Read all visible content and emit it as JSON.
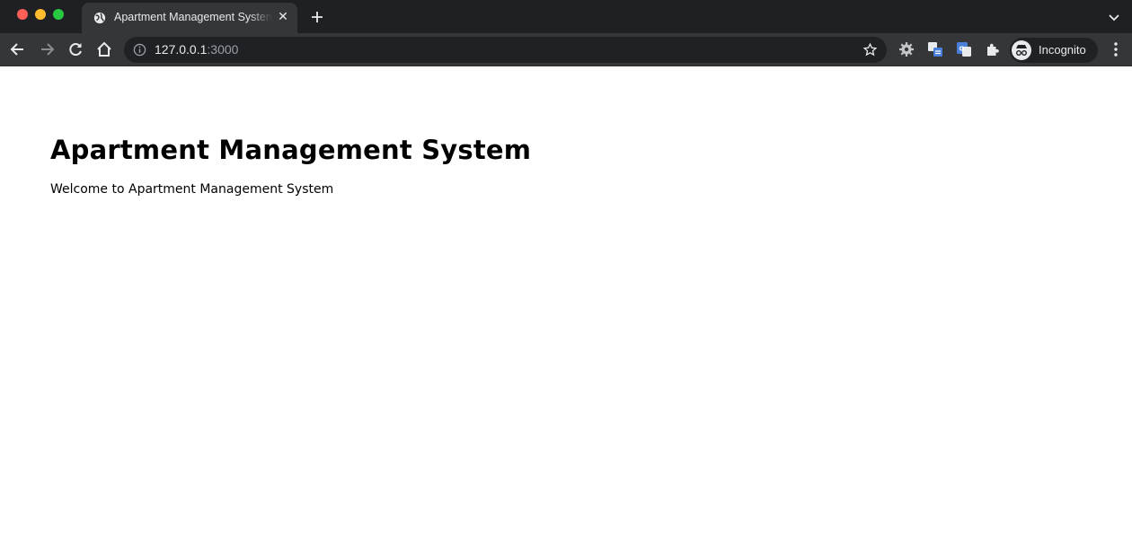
{
  "browser": {
    "tab": {
      "title": "Apartment Management System",
      "favicon": "globe-icon"
    },
    "address_bar": {
      "host": "127.0.0.1",
      "port": ":3000"
    },
    "profile": {
      "label": "Incognito"
    },
    "icons": [
      "back-icon",
      "forward-icon",
      "reload-icon",
      "home-icon",
      "info-icon",
      "bookmark-star-icon",
      "settings-extension-icon",
      "translate-extension-icon",
      "google-translate-icon",
      "extensions-puzzle-icon",
      "incognito-icon",
      "more-menu-icon",
      "new-tab-icon",
      "tab-close-icon",
      "tab-search-chevron-icon"
    ]
  },
  "page": {
    "heading": "Apartment Management System",
    "welcome_text": "Welcome to Apartment Management System"
  }
}
